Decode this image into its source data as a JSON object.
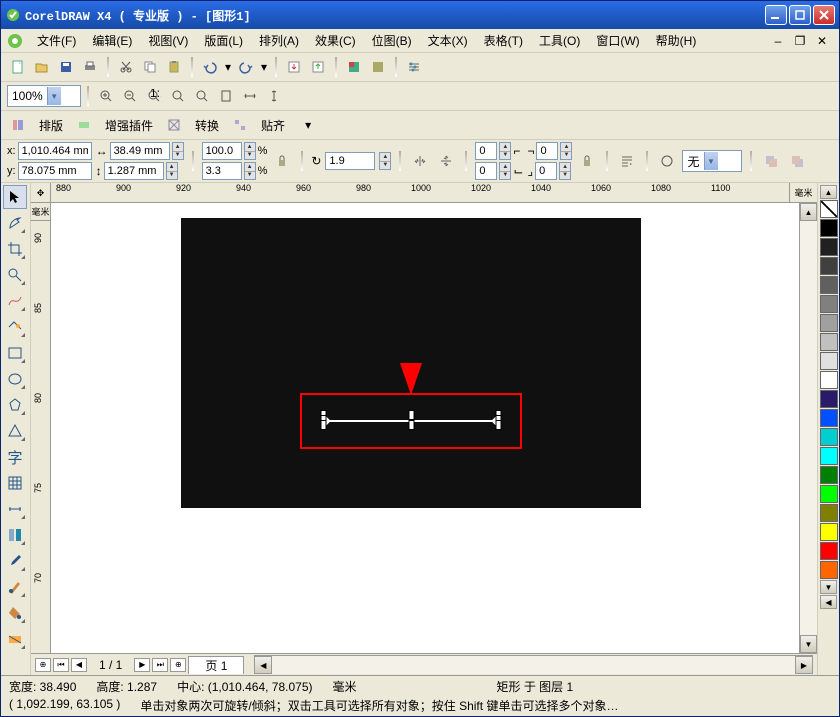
{
  "title": "CorelDRAW X4 ( 专业版 ) - [图形1]",
  "menus": {
    "file": "文件(F)",
    "edit": "编辑(E)",
    "view": "视图(V)",
    "layout": "版面(L)",
    "arrange": "排列(A)",
    "effect": "效果(C)",
    "bitmap": "位图(B)",
    "text": "文本(X)",
    "table": "表格(T)",
    "tools": "工具(O)",
    "window": "窗口(W)",
    "help": "帮助(H)"
  },
  "toolbar2": {
    "zoom": "100%"
  },
  "toolbar3": {
    "t1": "排版",
    "t2": "增强插件",
    "t3": "转换",
    "t4": "贴齐"
  },
  "props": {
    "x_label": "x:",
    "x": "1,010.464 mm",
    "y_label": "y:",
    "y": "78.075 mm",
    "w": "38.49 mm",
    "h": "1.287 mm",
    "sx": "100.0",
    "sy": "3.3",
    "pct": "%",
    "angle": "1.9",
    "n1": "0",
    "n2": "0",
    "n3": "0",
    "n4": "0",
    "fill": "无"
  },
  "hruler_ticks": [
    "880",
    "900",
    "920",
    "940",
    "960",
    "980",
    "1000",
    "1020",
    "1040",
    "1060",
    "1080",
    "1100"
  ],
  "hruler_unit": "毫米",
  "vruler_ticks": [
    "90",
    "85",
    "80",
    "75",
    "70"
  ],
  "vruler_unit": "毫米",
  "pagenav": {
    "page_cur": "1 / 1",
    "tab": "页 1"
  },
  "status": {
    "r1_w": "宽度: 38.490",
    "r1_h": "高度: 1.287",
    "r1_c": "中心: (1,010.464, 78.075)",
    "r1_u": "毫米",
    "r1_layer": "矩形 于 图层 1",
    "r2_pos": "( 1,092.199, 63.105 )",
    "r2_hint": "单击对象两次可旋转/倾斜；双击工具可选择所有对象；按住 Shift 键单击可选择多个对象…"
  }
}
